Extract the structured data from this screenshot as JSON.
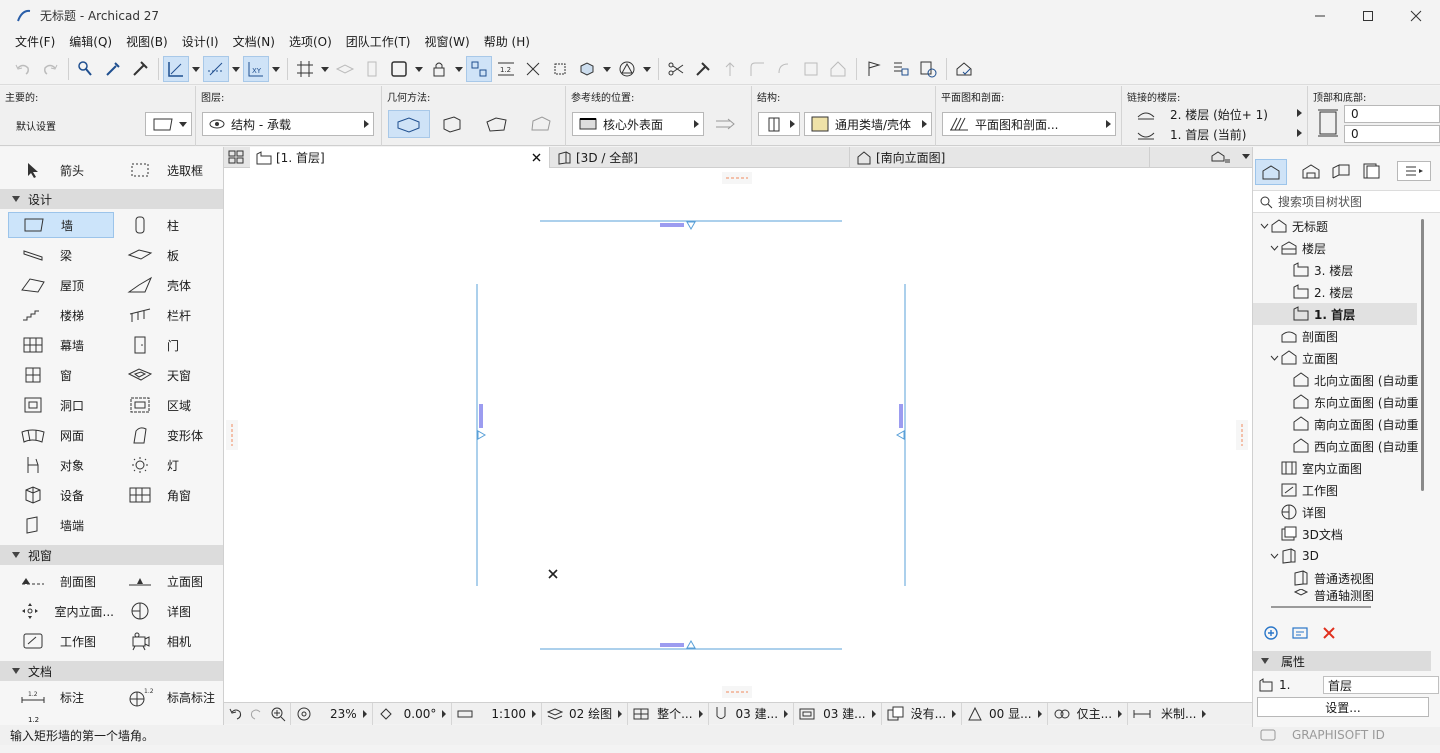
{
  "window": {
    "title": "无标题 - Archicad 27"
  },
  "menu": [
    "文件(F)",
    "编辑(Q)",
    "视图(B)",
    "设计(I)",
    "文档(N)",
    "选项(O)",
    "团队工作(T)",
    "视窗(W)",
    "帮助 (H)"
  ],
  "infobox": {
    "main_label": "主要的:",
    "main_value": "默认设置",
    "layer_label": "图层:",
    "layer_value": "结构 - 承载",
    "geometry_label": "几何方法:",
    "refline_label": "参考线的位置:",
    "refline_value": "核心外表面",
    "structure_label": "结构:",
    "structure_value": "通用类墙/壳体",
    "plansection_label": "平面图和剖面:",
    "plansection_value": "平面图和剖面...",
    "linked_label": "链接的楼层:",
    "linked_top": "2. 楼层 (始位+ 1)",
    "linked_bottom": "1. 首层 (当前)",
    "topbottom_label": "顶部和底部:",
    "top_value": "0",
    "bottom_value": "0"
  },
  "toolbox": {
    "arrow": "箭头",
    "marquee": "选取框",
    "groups": {
      "design": "设计",
      "viewpoint": "视窗",
      "document": "文档"
    },
    "design_tools": [
      "墙",
      "柱",
      "梁",
      "板",
      "屋顶",
      "壳体",
      "楼梯",
      "栏杆",
      "幕墙",
      "门",
      "窗",
      "天窗",
      "洞口",
      "区域",
      "网面",
      "变形体",
      "对象",
      "灯",
      "设备",
      "角窗",
      "墙端"
    ],
    "viewpoint_tools": [
      "剖面图",
      "立面图",
      "室内立面...",
      "详图",
      "工作图",
      "相机"
    ],
    "document_tools": [
      "标注",
      "标高标注"
    ]
  },
  "tabs": {
    "floor": "[1. 首层]",
    "threed": "[3D / 全部]",
    "elevation": "[南向立面图]"
  },
  "viewbar": {
    "zoom": "23%",
    "angle": "0.00°",
    "scale": "1:100",
    "layers": "02 绘图",
    "model": "整个...",
    "structure": "03 建...",
    "partial": "03 建...",
    "override": "没有...",
    "reno": "00 显...",
    "options": "仅主...",
    "dimension": "米制..."
  },
  "status": {
    "text": "输入矩形墙的第一个墙角。"
  },
  "navigator": {
    "search_placeholder": "搜索项目树状图",
    "root": "无标题",
    "stories": "楼层",
    "story3": "3. 楼层",
    "story2": "2. 楼层",
    "story1": "1. 首层",
    "sections": "剖面图",
    "elevations": "立面图",
    "north": "北向立面图 (自动重",
    "east": "东向立面图 (自动重",
    "south": "南向立面图 (自动重",
    "west": "西向立面图 (自动重",
    "interior": "室内立面图",
    "worksheets": "工作图",
    "details": "详图",
    "docs3d": "3D文档",
    "threed": "3D",
    "perspective": "普通透视图",
    "axon": "普通轴测图",
    "properties_title": "属性",
    "prop_id": "1.",
    "prop_name": "首层",
    "settings_button": "设置...",
    "brand": "GRAPHISOFT ID"
  }
}
